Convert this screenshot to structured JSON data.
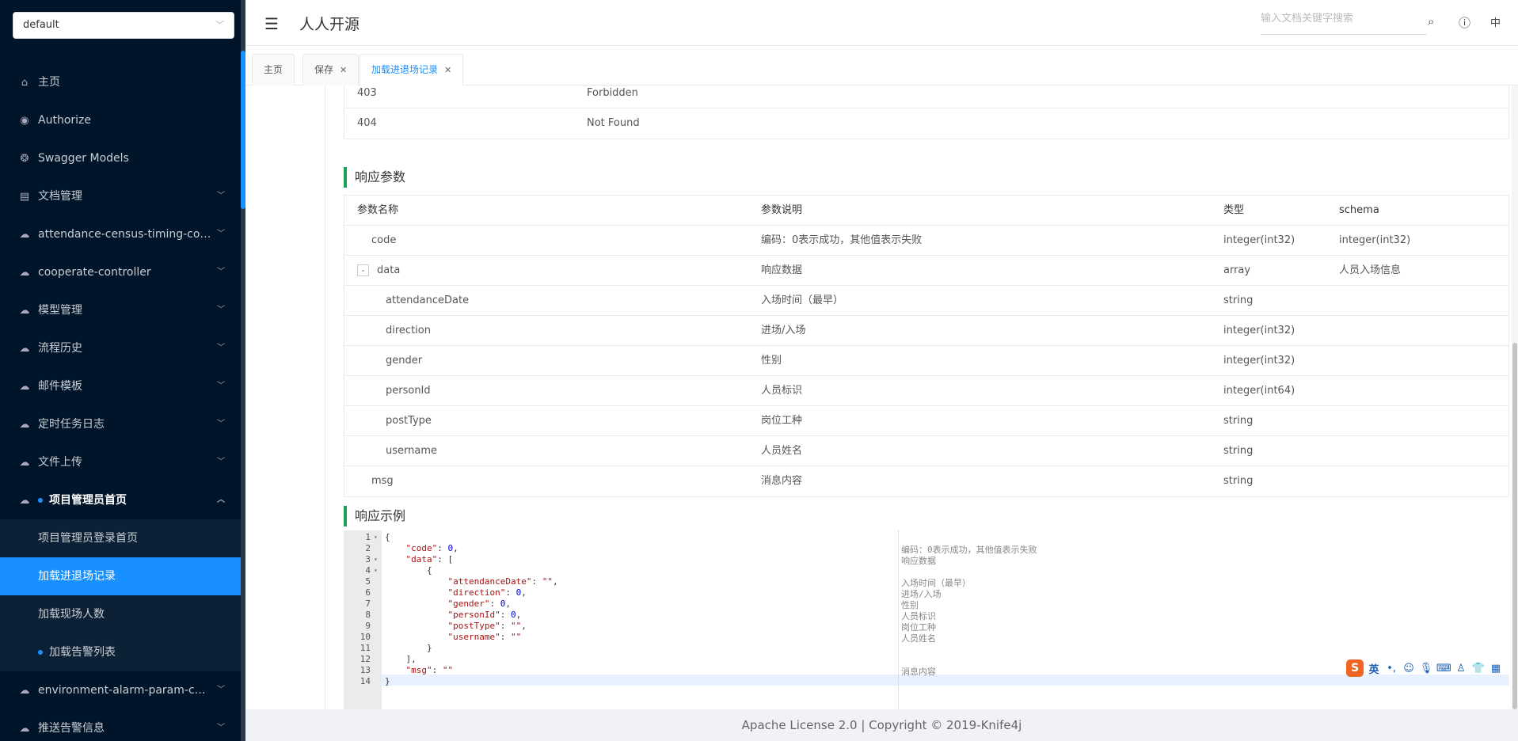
{
  "sidebar": {
    "group_select": "default",
    "items": [
      {
        "label": "主页",
        "icon": "home-icon",
        "glyph": "⌂"
      },
      {
        "label": "Authorize",
        "icon": "lock-icon",
        "glyph": "◉"
      },
      {
        "label": "Swagger Models",
        "icon": "cube-icon",
        "glyph": "❂"
      },
      {
        "label": "文档管理",
        "icon": "document-icon",
        "glyph": "▤"
      },
      {
        "label": "attendance-census-timing-controller",
        "icon": "cloud-icon",
        "glyph": "☁"
      },
      {
        "label": "cooperate-controller",
        "icon": "cloud-icon",
        "glyph": "☁"
      },
      {
        "label": "模型管理",
        "icon": "cloud-icon",
        "glyph": "☁"
      },
      {
        "label": "流程历史",
        "icon": "cloud-icon",
        "glyph": "☁"
      },
      {
        "label": "邮件模板",
        "icon": "cloud-icon",
        "glyph": "☁"
      },
      {
        "label": "定时任务日志",
        "icon": "cloud-icon",
        "glyph": "☁"
      },
      {
        "label": "文件上传",
        "icon": "cloud-icon",
        "glyph": "☁"
      },
      {
        "label": "项目管理员首页",
        "icon": "cloud-icon",
        "glyph": "☁"
      }
    ],
    "subitems": [
      {
        "label": "项目管理员登录首页"
      },
      {
        "label": "加载进退场记录"
      },
      {
        "label": "加载现场人数"
      },
      {
        "label": "加载告警列表"
      }
    ],
    "after_items": [
      {
        "label": "environment-alarm-param-controller",
        "icon": "cloud-icon",
        "glyph": "☁"
      },
      {
        "label": "推送告警信息",
        "icon": "cloud-icon",
        "glyph": "☁"
      }
    ]
  },
  "header": {
    "title": "人人开源",
    "search_placeholder": "输入文档关键字搜索",
    "lang": "中"
  },
  "tabs": [
    {
      "label": "主页"
    },
    {
      "label": "保存"
    },
    {
      "label": "加载进退场记录"
    }
  ],
  "status_table": [
    {
      "code": "403",
      "desc": "Forbidden"
    },
    {
      "code": "404",
      "desc": "Not Found"
    }
  ],
  "response_params": {
    "title": "响应参数",
    "headers": [
      "参数名称",
      "参数说明",
      "类型",
      "schema"
    ],
    "rows": [
      {
        "name": "code",
        "desc": "编码：0表示成功，其他值表示失败",
        "type": "integer(int32)",
        "schema": "integer(int32)",
        "level": 1
      },
      {
        "name": "data",
        "desc": "响应数据",
        "type": "array",
        "schema": "人员入场信息",
        "level": 1,
        "toggle": "-"
      },
      {
        "name": "attendanceDate",
        "desc": "入场时间（最早）",
        "type": "string",
        "schema": "",
        "level": 2
      },
      {
        "name": "direction",
        "desc": "进场/入场",
        "type": "integer(int32)",
        "schema": "",
        "level": 2
      },
      {
        "name": "gender",
        "desc": "性别",
        "type": "integer(int32)",
        "schema": "",
        "level": 2
      },
      {
        "name": "personId",
        "desc": "人员标识",
        "type": "integer(int64)",
        "schema": "",
        "level": 2
      },
      {
        "name": "postType",
        "desc": "岗位工种",
        "type": "string",
        "schema": "",
        "level": 2
      },
      {
        "name": "username",
        "desc": "人员姓名",
        "type": "string",
        "schema": "",
        "level": 2
      },
      {
        "name": "msg",
        "desc": "消息内容",
        "type": "string",
        "schema": "",
        "level": 1
      }
    ]
  },
  "response_example": {
    "title": "响应示例",
    "lines": [
      {
        "n": "1",
        "fold": "▾",
        "code": "{",
        "note": ""
      },
      {
        "n": "2",
        "fold": "",
        "code": "    \"code\": 0,",
        "note": "编码：0表示成功，其他值表示失败"
      },
      {
        "n": "3",
        "fold": "▾",
        "code": "    \"data\": [",
        "note": "响应数据"
      },
      {
        "n": "4",
        "fold": "▾",
        "code": "        {",
        "note": ""
      },
      {
        "n": "5",
        "fold": "",
        "code": "            \"attendanceDate\": \"\",",
        "note": "入场时间（最早）"
      },
      {
        "n": "6",
        "fold": "",
        "code": "            \"direction\": 0,",
        "note": "进场/入场"
      },
      {
        "n": "7",
        "fold": "",
        "code": "            \"gender\": 0,",
        "note": "性别"
      },
      {
        "n": "8",
        "fold": "",
        "code": "            \"personId\": 0,",
        "note": "人员标识"
      },
      {
        "n": "9",
        "fold": "",
        "code": "            \"postType\": \"\",",
        "note": "岗位工种"
      },
      {
        "n": "10",
        "fold": "",
        "code": "            \"username\": \"\"",
        "note": "人员姓名"
      },
      {
        "n": "11",
        "fold": "",
        "code": "        }",
        "note": ""
      },
      {
        "n": "12",
        "fold": "",
        "code": "    ],",
        "note": ""
      },
      {
        "n": "13",
        "fold": "",
        "code": "    \"msg\": \"\"",
        "note": "消息内容"
      },
      {
        "n": "14",
        "fold": "",
        "code": "}",
        "note": ""
      }
    ]
  },
  "ime": {
    "logo": "S",
    "lang": "英",
    "icons": [
      "punct-icon",
      "emoji-icon",
      "mic-icon",
      "keyboard-icon",
      "user-icon",
      "skin-icon",
      "grid-icon"
    ]
  },
  "footer": {
    "text": "Apache License 2.0 | Copyright © 2019-Knife4j"
  },
  "colors": {
    "sidebar_bg": "#001529",
    "accent": "#1890ff",
    "section_bar": "#1aa259"
  }
}
